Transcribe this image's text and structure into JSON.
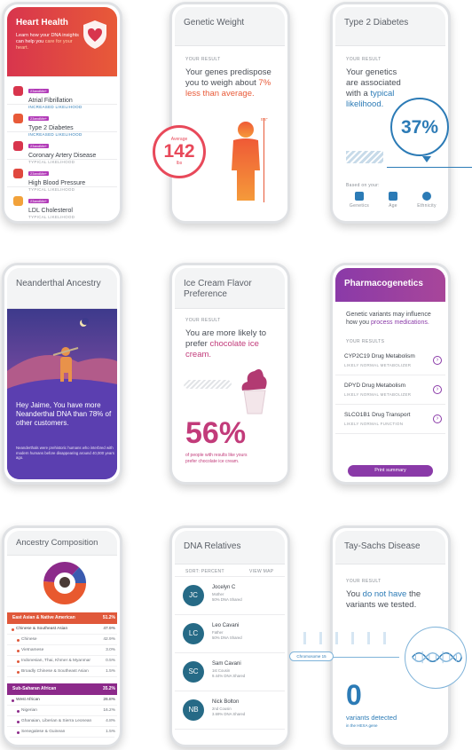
{
  "colors": {
    "heart": "#d8354d",
    "orange": "#e85a38",
    "purple": "#8a3aa8",
    "blue": "#2c7bb6",
    "teal": "#266a86",
    "pink": "#c23b7a"
  },
  "heart": {
    "title": "Heart Health",
    "subtitle_pre": "Learn how your DNA insights can help you",
    "subtitle_link": "care for your heart.",
    "tag": "23andMe+",
    "items": [
      {
        "name": "Atrial Fibrillation",
        "likelihood": "INCREASED LIKELIHOOD",
        "icon": "heart-icon"
      },
      {
        "name": "Type 2 Diabetes",
        "likelihood": "INCREASED LIKELIHOOD",
        "icon": "blood-drop-icon"
      },
      {
        "name": "Coronary Artery Disease",
        "likelihood": "TYPICAL LIKELIHOOD",
        "icon": "heart-icon"
      },
      {
        "name": "High Blood Pressure",
        "likelihood": "TYPICAL LIKELIHOOD",
        "icon": "heart-icon"
      },
      {
        "name": "LDL Cholesterol",
        "likelihood": "TYPICAL LIKELIHOOD",
        "icon": "drop-icon"
      }
    ]
  },
  "weight": {
    "title": "Genetic Weight",
    "result_label": "YOUR RESULT",
    "text_pre": "Your genes predispose you to weigh about",
    "text_hl": "7% less than average.",
    "avg_label": "Average",
    "avg_value": "142",
    "avg_unit": "lbs",
    "height_label": "5'4\""
  },
  "diabetes": {
    "title": "Type 2 Diabetes",
    "result_label": "YOUR RESULT",
    "text_pre": "Your genetics are associated with a",
    "text_hl": "typical likelihood.",
    "percent": "37%",
    "based_on": "Based on your:",
    "factors": [
      {
        "label": "Genetics",
        "icon": "dna-icon"
      },
      {
        "label": "Age",
        "icon": "calendar-icon"
      },
      {
        "label": "Ethnicity",
        "icon": "globe-icon"
      }
    ]
  },
  "neanderthal": {
    "title": "Neanderthal Ancestry",
    "headline": "Hey Jaime, You have more Neanderthal DNA than 78% of other customers.",
    "body": "Neanderthals were prehistoric humans who interbred with modern humans before disappearing around 40,000 years ago."
  },
  "icecream": {
    "title": "Ice Cream Flavor Preference",
    "result_label": "YOUR RESULT",
    "text_pre": "You are more likely to prefer",
    "text_hl": "chocolate ice cream.",
    "percent": "56%",
    "caption": "of people with results like yours prefer chocolate ice cream."
  },
  "pharma": {
    "title": "Pharmacogenetics",
    "intro_pre": "Genetic variants may influence how you",
    "intro_hl": "process medications.",
    "results_label": "YOUR RESULTS",
    "items": [
      {
        "name": "CYP2C19 Drug Metabolism",
        "status": "LIKELY NORMAL METABOLIZER"
      },
      {
        "name": "DPYD Drug Metabolism",
        "status": "LIKELY NORMAL METABOLIZER"
      },
      {
        "name": "SLCO1B1 Drug Transport",
        "status": "LIKELY NORMAL FUNCTION"
      }
    ],
    "button": "Print summary"
  },
  "ancestry": {
    "title": "Ancestry Composition",
    "band1": {
      "label": "East Asian & Native American",
      "value": "51.2%"
    },
    "rows1": [
      {
        "label": "Chinese & Southeast Asian",
        "value": "47.9%",
        "sub": false
      },
      {
        "label": "Chinese",
        "value": "42.9%",
        "sub": true
      },
      {
        "label": "Vietnamese",
        "value": "3.0%",
        "sub": true
      },
      {
        "label": "Indonesian, Thai, Khmer & Myanmar",
        "value": "0.5%",
        "sub": true
      },
      {
        "label": "Broadly Chinese & Southeast Asian",
        "value": "1.5%",
        "sub": true
      }
    ],
    "band2": {
      "label": "Sub-Saharan African",
      "value": "35.2%"
    },
    "rows2": [
      {
        "label": "West African",
        "value": "26.8%",
        "sub": false
      },
      {
        "label": "Nigerian",
        "value": "16.2%",
        "sub": true
      },
      {
        "label": "Ghanaian, Liberian & Sierra Leonean",
        "value": "4.8%",
        "sub": true
      },
      {
        "label": "Senegalese & Guinean",
        "value": "1.5%",
        "sub": true
      }
    ]
  },
  "relatives": {
    "title": "DNA Relatives",
    "sort_label": "SORT: PERCENT",
    "map_label": "VIEW MAP",
    "people": [
      {
        "initials": "JC",
        "name": "Jocelyn C",
        "rel": "Mother",
        "share": "50% DNA Shared"
      },
      {
        "initials": "LC",
        "name": "Leo Cavani",
        "rel": "Father",
        "share": "50% DNA Shared"
      },
      {
        "initials": "SC",
        "name": "Sam Cavani",
        "rel": "1st Cousin",
        "share": "9.44% DNA Shared"
      },
      {
        "initials": "NB",
        "name": "Nick Bolton",
        "rel": "2nd Cousin",
        "share": "3.69% DNA Shared"
      }
    ]
  },
  "taysachs": {
    "title": "Tay-Sachs Disease",
    "result_label": "YOUR RESULT",
    "text_pre": "You",
    "text_hl": "do not have",
    "text_post": "the variants we tested.",
    "chromosome": "Chromosome 15",
    "count": "0",
    "detected": "variants detected",
    "gene": "in the HEXA gene"
  }
}
